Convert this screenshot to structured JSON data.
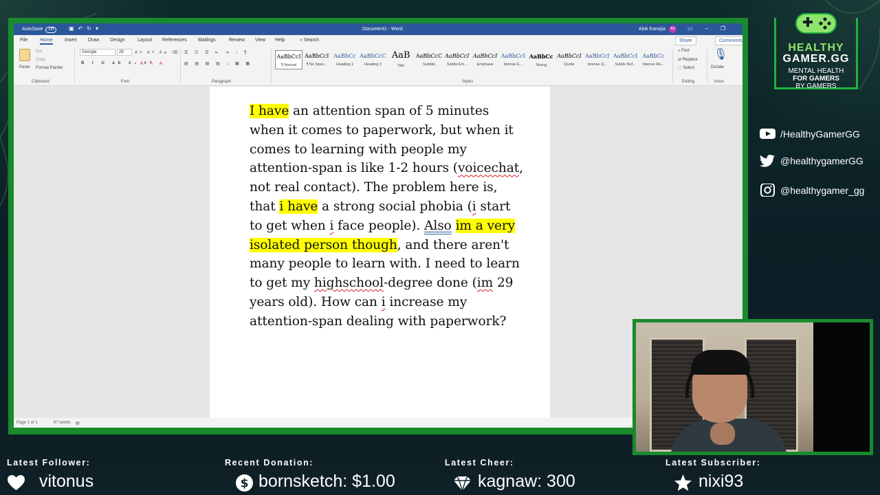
{
  "word": {
    "titlebar": {
      "autosave_label": "AutoSave",
      "autosave_state": "Off",
      "search_label": "Search",
      "document_title": "Document1 - Word",
      "user_name": "Alok Kanojia",
      "user_initials": "AK"
    },
    "menu_tabs": [
      "File",
      "Home",
      "Insert",
      "Draw",
      "Design",
      "Layout",
      "References",
      "Mailings",
      "Review",
      "View",
      "Help"
    ],
    "active_tab": "Home",
    "share_label": "Share",
    "comments_label": "Comments",
    "ribbon": {
      "clipboard": {
        "paste": "Paste",
        "cut": "Cut",
        "copy": "Copy",
        "format_painter": "Format Painter",
        "label": "Clipboard"
      },
      "font": {
        "family": "Georgia",
        "size": "28",
        "label": "Font"
      },
      "paragraph": {
        "label": "Paragraph"
      },
      "styles": {
        "label": "Styles",
        "items": [
          {
            "sample": "AaBbCcI",
            "name": "¶ Normal"
          },
          {
            "sample": "AaBbCcI",
            "name": "¶ No Spac..."
          },
          {
            "sample": "AaBbCc",
            "name": "Heading 1"
          },
          {
            "sample": "AaBbCcC",
            "name": "Heading 2"
          },
          {
            "sample": "AaB",
            "name": "Title"
          },
          {
            "sample": "AaBbCcC",
            "name": "Subtitle"
          },
          {
            "sample": "AaBbCcI",
            "name": "Subtle Em..."
          },
          {
            "sample": "AaBbCcI",
            "name": "Emphasis"
          },
          {
            "sample": "AaBbCcI",
            "name": "Intense E..."
          },
          {
            "sample": "AaBbCc",
            "name": "Strong"
          },
          {
            "sample": "AaBbCcI",
            "name": "Quote"
          },
          {
            "sample": "AaBbCcI",
            "name": "Intense Q..."
          },
          {
            "sample": "AaBbCcI",
            "name": "Subtle Ref..."
          },
          {
            "sample": "AaBbCc",
            "name": "Intense Re..."
          }
        ]
      },
      "editing": {
        "find": "Find",
        "replace": "Replace",
        "select": "Select",
        "label": "Editing"
      },
      "voice": {
        "dictate": "Dictate",
        "label": "Voice"
      }
    },
    "document": {
      "segments": [
        {
          "text": "I have",
          "hl": true
        },
        {
          "text": " an attention span of 5 minutes when it comes to paperwork, but when it comes to learning with people my attention-span is like 1-2 hours (",
          "hl": false
        },
        {
          "text": "voicechat",
          "hl": false,
          "spell": true
        },
        {
          "text": ", not real contact). The problem here is, that ",
          "hl": false
        },
        {
          "text": "i have",
          "hl": true
        },
        {
          "text": " a strong social phobia (",
          "hl": false
        },
        {
          "text": "i",
          "hl": false,
          "spell": true
        },
        {
          "text": " start to get when ",
          "hl": false
        },
        {
          "text": "i",
          "hl": false,
          "spell": true
        },
        {
          "text": " face people). ",
          "hl": false
        },
        {
          "text": "Also",
          "hl": false,
          "grammar": true
        },
        {
          "text": " ",
          "hl": false
        },
        {
          "text": "im a very isolated person though",
          "hl": true
        },
        {
          "text": ", and there aren't many people to learn with. I need to learn to get my ",
          "hl": false
        },
        {
          "text": "highschool",
          "hl": false,
          "spell": true
        },
        {
          "text": "-degree done (",
          "hl": false
        },
        {
          "text": "im",
          "hl": false,
          "spell": true
        },
        {
          "text": " 29 years old). How can ",
          "hl": false
        },
        {
          "text": "i",
          "hl": false,
          "spell": true
        },
        {
          "text": " increase my attention-span dealing with paperwork?",
          "hl": false
        }
      ]
    },
    "status": {
      "page": "Page 1 of 1",
      "words": "87 words"
    }
  },
  "branding": {
    "line1": "HEALTHY",
    "line2": "GAMER.GG",
    "tagline1": "MENTAL HEALTH",
    "tagline2": "FOR GAMERS",
    "tagline3": "BY GAMERS",
    "accent_color": "#1fb23d"
  },
  "socials": [
    {
      "icon": "youtube-icon",
      "handle": "/HealthyGamerGG"
    },
    {
      "icon": "twitter-icon",
      "handle": "@healthygamerGG"
    },
    {
      "icon": "instagram-icon",
      "handle": "@healthygamer_gg"
    }
  ],
  "alerts": {
    "follower": {
      "label": "Latest Follower:",
      "value": "vitonus",
      "icon": "heart-icon"
    },
    "donation": {
      "label": "Recent Donation:",
      "value": "bornsketch: $1.00",
      "icon": "dollar-icon"
    },
    "cheer": {
      "label": "Latest Cheer:",
      "value": "kagnaw: 300",
      "icon": "diamond-icon"
    },
    "subscriber": {
      "label": "Latest Subscriber:",
      "value": "nixi93",
      "icon": "star-icon"
    }
  }
}
